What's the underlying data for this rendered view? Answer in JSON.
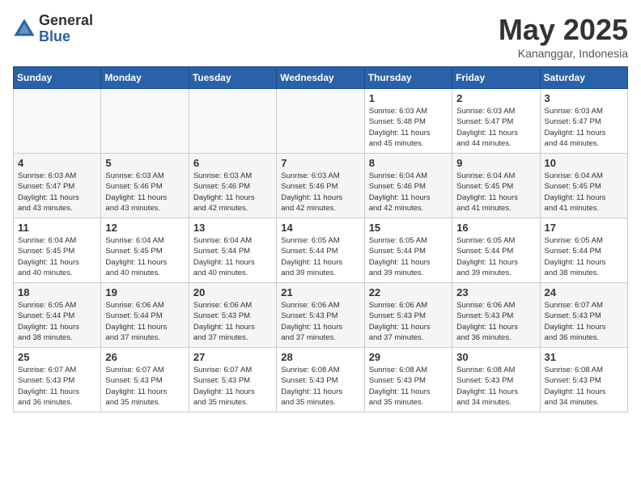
{
  "header": {
    "logo_general": "General",
    "logo_blue": "Blue",
    "month_year": "May 2025",
    "location": "Kananggar, Indonesia"
  },
  "weekdays": [
    "Sunday",
    "Monday",
    "Tuesday",
    "Wednesday",
    "Thursday",
    "Friday",
    "Saturday"
  ],
  "weeks": [
    [
      {
        "day": "",
        "info": ""
      },
      {
        "day": "",
        "info": ""
      },
      {
        "day": "",
        "info": ""
      },
      {
        "day": "",
        "info": ""
      },
      {
        "day": "1",
        "info": "Sunrise: 6:03 AM\nSunset: 5:48 PM\nDaylight: 11 hours\nand 45 minutes."
      },
      {
        "day": "2",
        "info": "Sunrise: 6:03 AM\nSunset: 5:47 PM\nDaylight: 11 hours\nand 44 minutes."
      },
      {
        "day": "3",
        "info": "Sunrise: 6:03 AM\nSunset: 5:47 PM\nDaylight: 11 hours\nand 44 minutes."
      }
    ],
    [
      {
        "day": "4",
        "info": "Sunrise: 6:03 AM\nSunset: 5:47 PM\nDaylight: 11 hours\nand 43 minutes."
      },
      {
        "day": "5",
        "info": "Sunrise: 6:03 AM\nSunset: 5:46 PM\nDaylight: 11 hours\nand 43 minutes."
      },
      {
        "day": "6",
        "info": "Sunrise: 6:03 AM\nSunset: 5:46 PM\nDaylight: 11 hours\nand 42 minutes."
      },
      {
        "day": "7",
        "info": "Sunrise: 6:03 AM\nSunset: 5:46 PM\nDaylight: 11 hours\nand 42 minutes."
      },
      {
        "day": "8",
        "info": "Sunrise: 6:04 AM\nSunset: 5:46 PM\nDaylight: 11 hours\nand 42 minutes."
      },
      {
        "day": "9",
        "info": "Sunrise: 6:04 AM\nSunset: 5:45 PM\nDaylight: 11 hours\nand 41 minutes."
      },
      {
        "day": "10",
        "info": "Sunrise: 6:04 AM\nSunset: 5:45 PM\nDaylight: 11 hours\nand 41 minutes."
      }
    ],
    [
      {
        "day": "11",
        "info": "Sunrise: 6:04 AM\nSunset: 5:45 PM\nDaylight: 11 hours\nand 40 minutes."
      },
      {
        "day": "12",
        "info": "Sunrise: 6:04 AM\nSunset: 5:45 PM\nDaylight: 11 hours\nand 40 minutes."
      },
      {
        "day": "13",
        "info": "Sunrise: 6:04 AM\nSunset: 5:44 PM\nDaylight: 11 hours\nand 40 minutes."
      },
      {
        "day": "14",
        "info": "Sunrise: 6:05 AM\nSunset: 5:44 PM\nDaylight: 11 hours\nand 39 minutes."
      },
      {
        "day": "15",
        "info": "Sunrise: 6:05 AM\nSunset: 5:44 PM\nDaylight: 11 hours\nand 39 minutes."
      },
      {
        "day": "16",
        "info": "Sunrise: 6:05 AM\nSunset: 5:44 PM\nDaylight: 11 hours\nand 39 minutes."
      },
      {
        "day": "17",
        "info": "Sunrise: 6:05 AM\nSunset: 5:44 PM\nDaylight: 11 hours\nand 38 minutes."
      }
    ],
    [
      {
        "day": "18",
        "info": "Sunrise: 6:05 AM\nSunset: 5:44 PM\nDaylight: 11 hours\nand 38 minutes."
      },
      {
        "day": "19",
        "info": "Sunrise: 6:06 AM\nSunset: 5:44 PM\nDaylight: 11 hours\nand 37 minutes."
      },
      {
        "day": "20",
        "info": "Sunrise: 6:06 AM\nSunset: 5:43 PM\nDaylight: 11 hours\nand 37 minutes."
      },
      {
        "day": "21",
        "info": "Sunrise: 6:06 AM\nSunset: 5:43 PM\nDaylight: 11 hours\nand 37 minutes."
      },
      {
        "day": "22",
        "info": "Sunrise: 6:06 AM\nSunset: 5:43 PM\nDaylight: 11 hours\nand 37 minutes."
      },
      {
        "day": "23",
        "info": "Sunrise: 6:06 AM\nSunset: 5:43 PM\nDaylight: 11 hours\nand 36 minutes."
      },
      {
        "day": "24",
        "info": "Sunrise: 6:07 AM\nSunset: 5:43 PM\nDaylight: 11 hours\nand 36 minutes."
      }
    ],
    [
      {
        "day": "25",
        "info": "Sunrise: 6:07 AM\nSunset: 5:43 PM\nDaylight: 11 hours\nand 36 minutes."
      },
      {
        "day": "26",
        "info": "Sunrise: 6:07 AM\nSunset: 5:43 PM\nDaylight: 11 hours\nand 35 minutes."
      },
      {
        "day": "27",
        "info": "Sunrise: 6:07 AM\nSunset: 5:43 PM\nDaylight: 11 hours\nand 35 minutes."
      },
      {
        "day": "28",
        "info": "Sunrise: 6:08 AM\nSunset: 5:43 PM\nDaylight: 11 hours\nand 35 minutes."
      },
      {
        "day": "29",
        "info": "Sunrise: 6:08 AM\nSunset: 5:43 PM\nDaylight: 11 hours\nand 35 minutes."
      },
      {
        "day": "30",
        "info": "Sunrise: 6:08 AM\nSunset: 5:43 PM\nDaylight: 11 hours\nand 34 minutes."
      },
      {
        "day": "31",
        "info": "Sunrise: 6:08 AM\nSunset: 5:43 PM\nDaylight: 11 hours\nand 34 minutes."
      }
    ]
  ]
}
